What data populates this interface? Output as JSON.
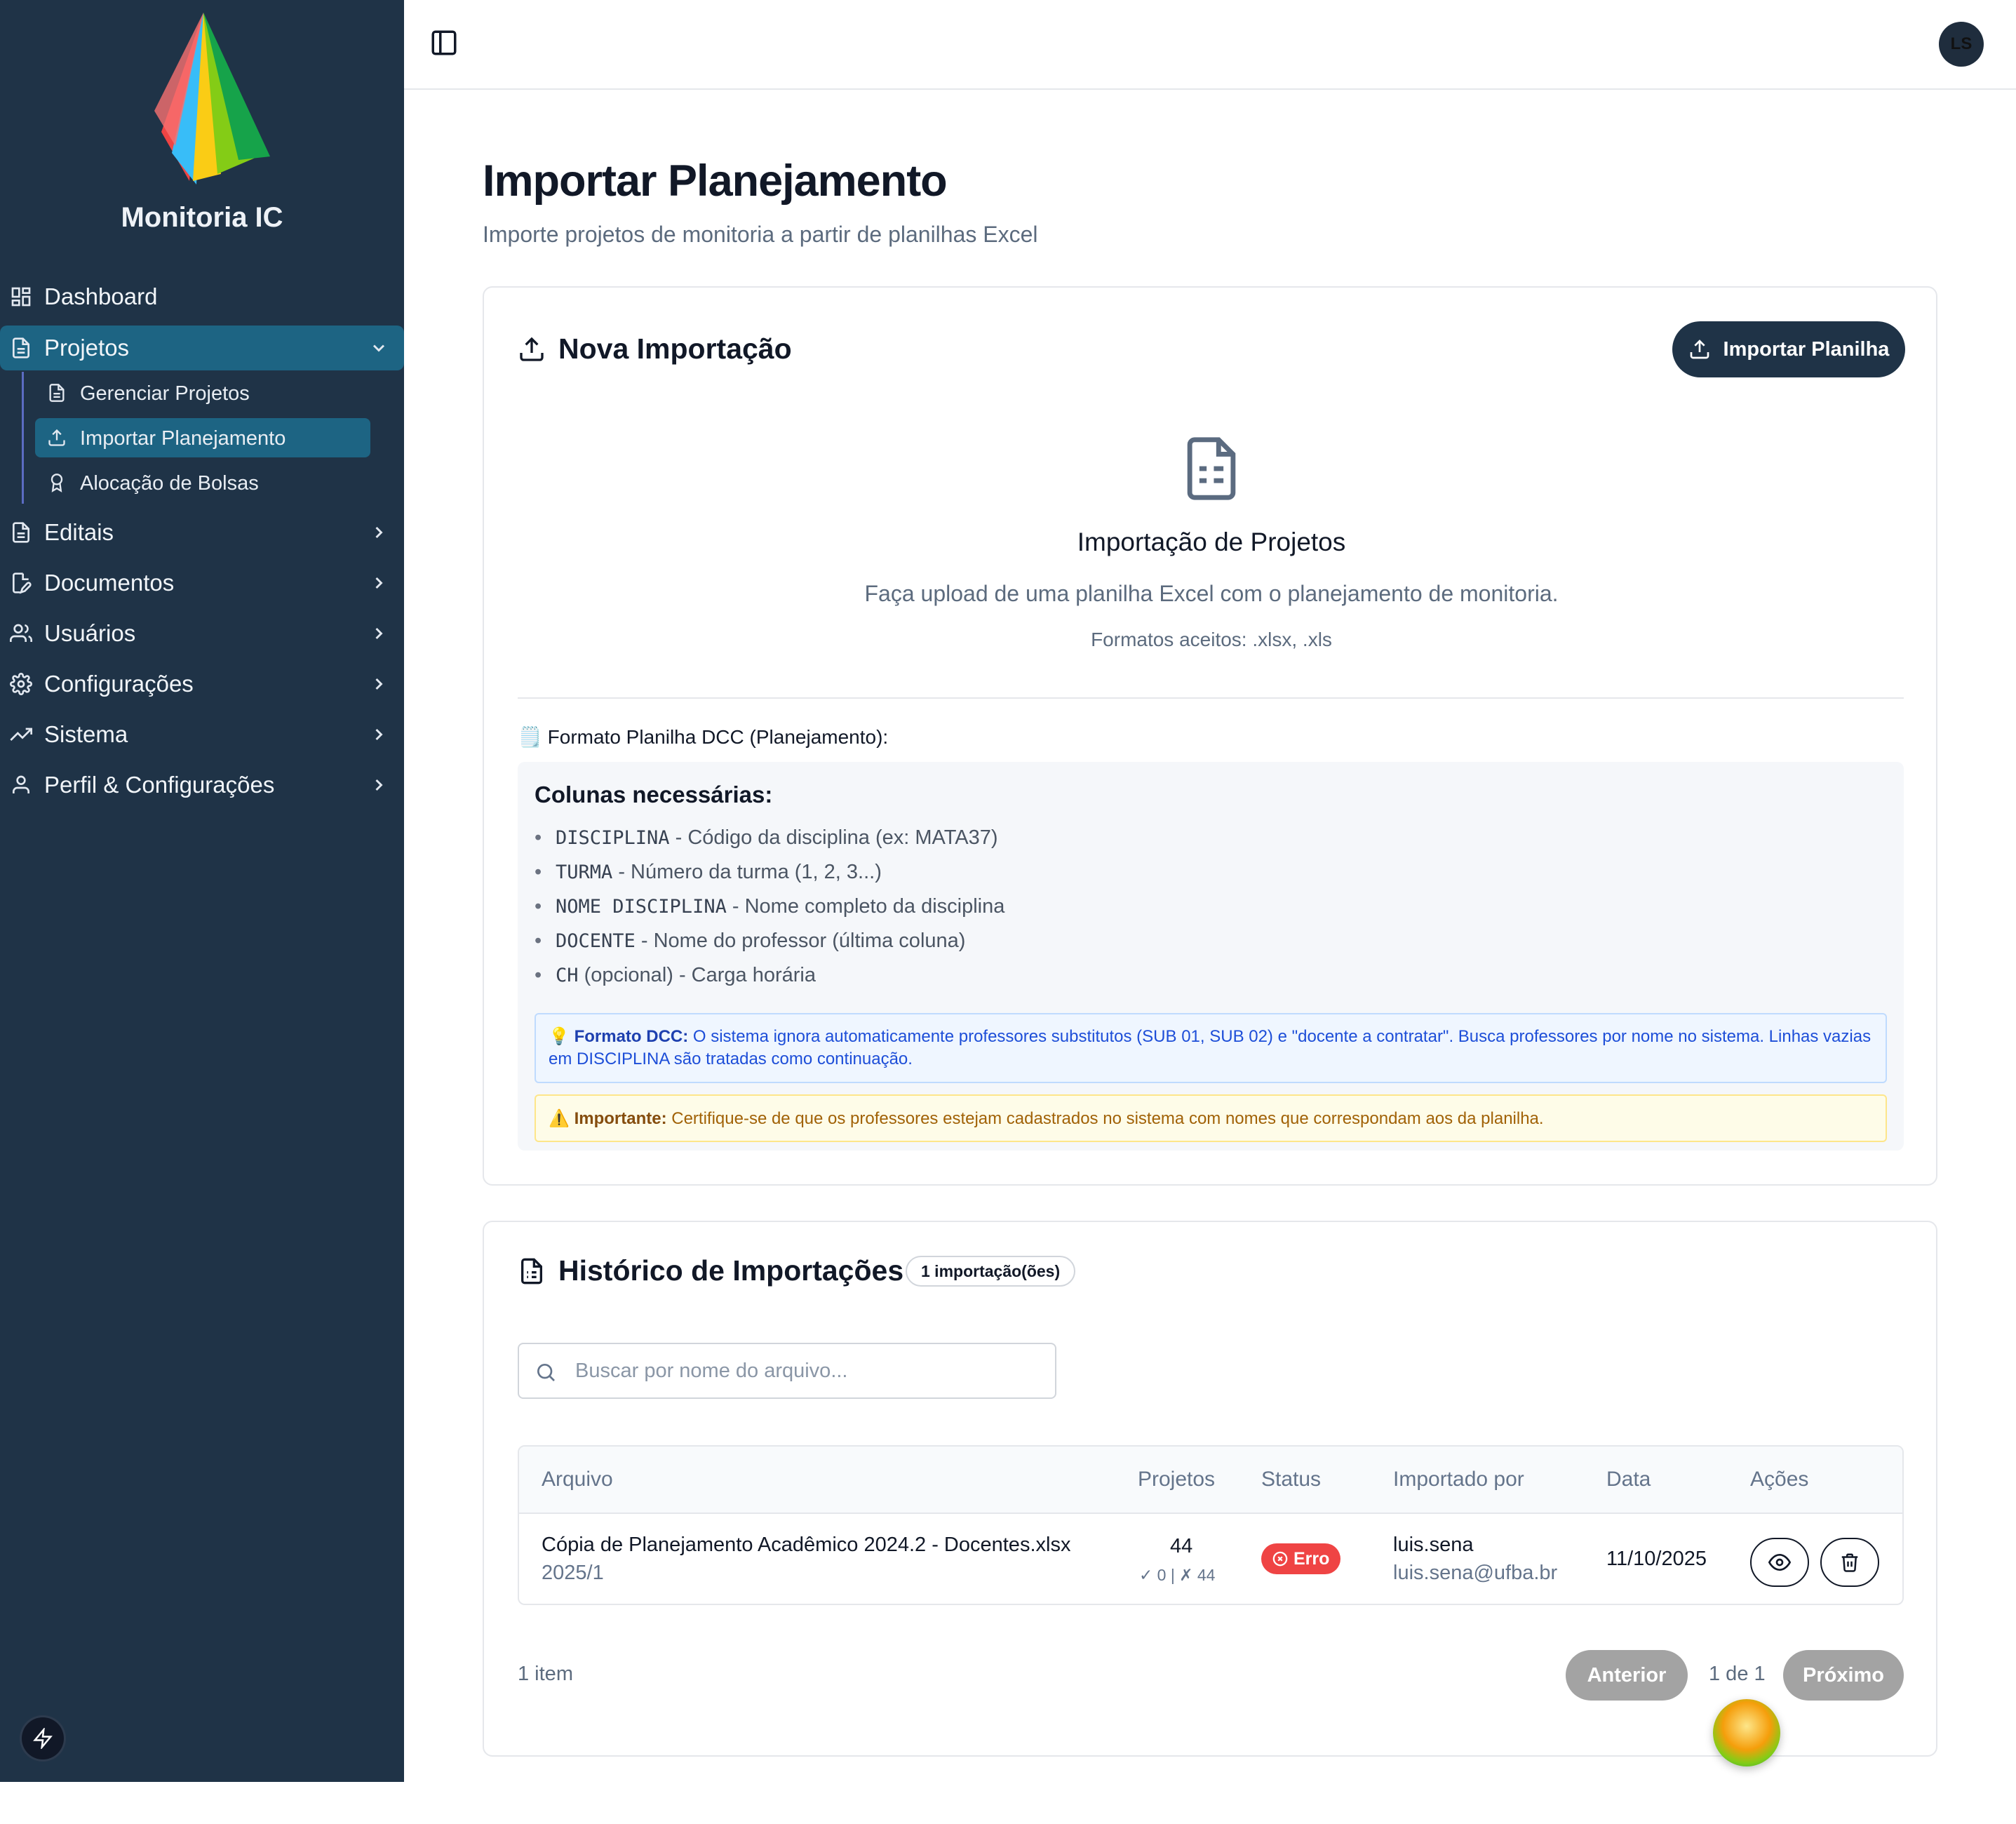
{
  "sidebar": {
    "brand": "Monitoria IC",
    "items": [
      {
        "label": "Dashboard",
        "icon": "grid-icon"
      },
      {
        "label": "Projetos",
        "icon": "file-icon"
      },
      {
        "label": "Editais",
        "icon": "file-icon"
      },
      {
        "label": "Documentos",
        "icon": "file-edit-icon"
      },
      {
        "label": "Usuários",
        "icon": "users-icon"
      },
      {
        "label": "Configurações",
        "icon": "gear-icon"
      },
      {
        "label": "Sistema",
        "icon": "trend-icon"
      },
      {
        "label": "Perfil & Configurações",
        "icon": "user-icon"
      }
    ],
    "subitems": [
      {
        "label": "Gerenciar Projetos",
        "icon": "file-icon"
      },
      {
        "label": "Importar Planejamento",
        "icon": "upload-icon"
      },
      {
        "label": "Alocação de Bolsas",
        "icon": "award-icon"
      }
    ]
  },
  "topbar": {
    "avatar_initials": "LS"
  },
  "page": {
    "title": "Importar Planejamento",
    "subtitle": "Importe projetos de monitoria a partir de planilhas Excel"
  },
  "import_card": {
    "title": "Nova Importação",
    "button_label": "Importar Planilha",
    "upload_title": "Importação de Projetos",
    "upload_desc": "Faça upload de uma planilha Excel com o planejamento de monitoria.",
    "formats": "Formatos aceitos: .xlsx, .xls",
    "format_heading": "Formato Planilha DCC (Planejamento):",
    "columns_heading": "Colunas necessárias:",
    "columns": [
      {
        "code": "DISCIPLINA",
        "desc": " - Código da disciplina (ex: MATA37)"
      },
      {
        "code": "TURMA",
        "desc": " - Número da turma (1, 2, 3...)"
      },
      {
        "code": "NOME DISCIPLINA",
        "desc": " - Nome completo da disciplina"
      },
      {
        "code": "DOCENTE",
        "desc": " - Nome do professor (última coluna)"
      },
      {
        "code": "CH",
        "desc": " (opcional) - Carga horária"
      }
    ],
    "note_dcc_label": "Formato DCC:",
    "note_dcc_text": " O sistema ignora automaticamente professores substitutos (SUB 01, SUB 02) e \"docente a contratar\". Busca professores por nome no sistema. Linhas vazias em DISCIPLINA são tratadas como continuação.",
    "note_important_label": "Importante:",
    "note_important_text": " Certifique-se de que os professores estejam cadastrados no sistema com nomes que correspondam aos da planilha."
  },
  "history": {
    "title": "Histórico de Importações",
    "badge": "1 importação(ões)",
    "search_placeholder": "Buscar por nome do arquivo...",
    "search_value": "",
    "columns": [
      "Arquivo",
      "Projetos",
      "Status",
      "Importado por",
      "Data",
      "Ações"
    ],
    "rows": [
      {
        "file": "Cópia de Planejamento Acadêmico 2024.2 - Docentes.xlsx",
        "period": "2025/1",
        "projects": "44",
        "projects_detail": "✓ 0 | ✗ 44",
        "status": "Erro",
        "user": "luis.sena",
        "email": "luis.sena@ufba.br",
        "date": "11/10/2025"
      }
    ],
    "count_label": "1 item",
    "prev_label": "Anterior",
    "page_label": "1 de 1",
    "next_label": "Próximo"
  }
}
